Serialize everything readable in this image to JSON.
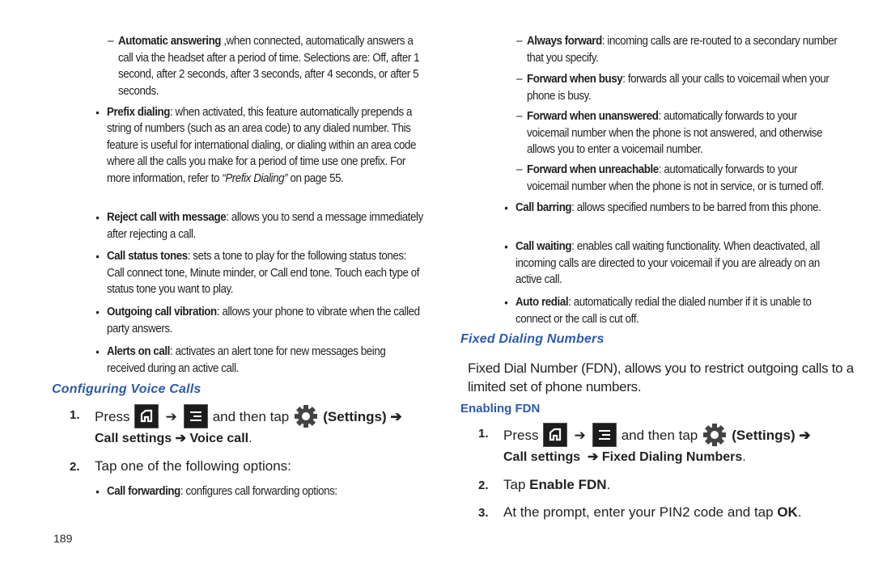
{
  "page_number": "189",
  "colors": {
    "heading": "#2e5aa8",
    "text": "#231f20",
    "icon_bg": "#1c1c1c"
  },
  "left": {
    "auto_answer": {
      "term": "Automatic answering",
      "text": " ,when connected, automatically answers a call via the headset after a period of time. Selections are: Off, after 1 second, after 2 seconds, after 3 seconds, after 4 seconds, or after 5 seconds."
    },
    "bullets": [
      {
        "term": "Prefix dialing",
        "text": ": when activated, this feature automatically prepends a string of numbers (such as an area code) to any dialed number. This feature is useful for international dialing, or dialing within an area code where all the calls you make for a period of time use one prefix. For more information, refer to ",
        "ref": "“Prefix Dialing”",
        "after": "  on page 55."
      },
      {
        "term": "Reject call with message",
        "text": ": allows you to send a message immediately after rejecting a call."
      },
      {
        "term": "Call status tones",
        "text": ": sets a tone to play for the following status tones: Call connect tone, Minute minder, or Call end tone. Touch each type of status tone you want to play."
      },
      {
        "term": "Outgoing call vibration",
        "text": ": allows your phone to vibrate when the called party answers."
      },
      {
        "term": "Alerts on call",
        "text": ": activates an alert tone for new messages being received during an active call."
      }
    ],
    "heading": "Configuring Voice Calls",
    "step1": {
      "num": "1.",
      "press": "Press",
      "arrow": "➔",
      "then": "and then tap",
      "settings": "(Settings)",
      "line2a": "Call settings",
      "line2b": "Voice call",
      "period": "."
    },
    "step2": {
      "num": "2.",
      "text": "Tap one of the following options:"
    },
    "call_forwarding": {
      "term": "Call forwarding",
      "text": ": configures call forwarding options:"
    }
  },
  "right": {
    "forward_items": [
      {
        "term": "Always forward",
        "text": ": incoming calls are re-routed to a secondary number that you specify."
      },
      {
        "term": "Forward when busy",
        "text": ": forwards all your calls to voicemail when your phone is busy."
      },
      {
        "term": "Forward when unanswered",
        "text": ": automatically forwards to your voicemail number when the phone is not answered, and otherwise allows you to enter a voicemail number."
      },
      {
        "term": "Forward when unreachable",
        "text": ": automatically forwards to your voicemail number when the phone is not in service, or is turned off."
      }
    ],
    "bullets": [
      {
        "term": "Call barring",
        "text": ": allows specified numbers to be barred from this phone."
      },
      {
        "term": "Call waiting",
        "text": ": enables call waiting functionality. When deactivated, all incoming calls are directed to your voicemail if you are already on an active call."
      },
      {
        "term": "Auto redial",
        "text": ": automatically redial the dialed number if it is unable to connect or the call is cut off."
      }
    ],
    "heading": "Fixed Dialing Numbers",
    "intro": "Fixed Dial Number (FDN), allows you to restrict outgoing calls to a limited set of phone numbers.",
    "subheading": "Enabling FDN",
    "step1": {
      "num": "1.",
      "press": "Press",
      "arrow": "➔",
      "then": "and then tap",
      "settings": "(Settings)",
      "line2a": "Call settings",
      "line2b": "Fixed Dialing Numbers",
      "period": "."
    },
    "step2": {
      "num": "2.",
      "pre": "Tap ",
      "term": "Enable FDN",
      "post": "."
    },
    "step3": {
      "num": "3.",
      "pre": "At the prompt, enter your PIN2 code and tap ",
      "term": "OK",
      "post": "."
    }
  },
  "icons": {
    "home": "home-key-icon",
    "menu": "menu-key-icon",
    "settings": "settings-gear-icon",
    "arrow": "right-arrow-icon"
  }
}
